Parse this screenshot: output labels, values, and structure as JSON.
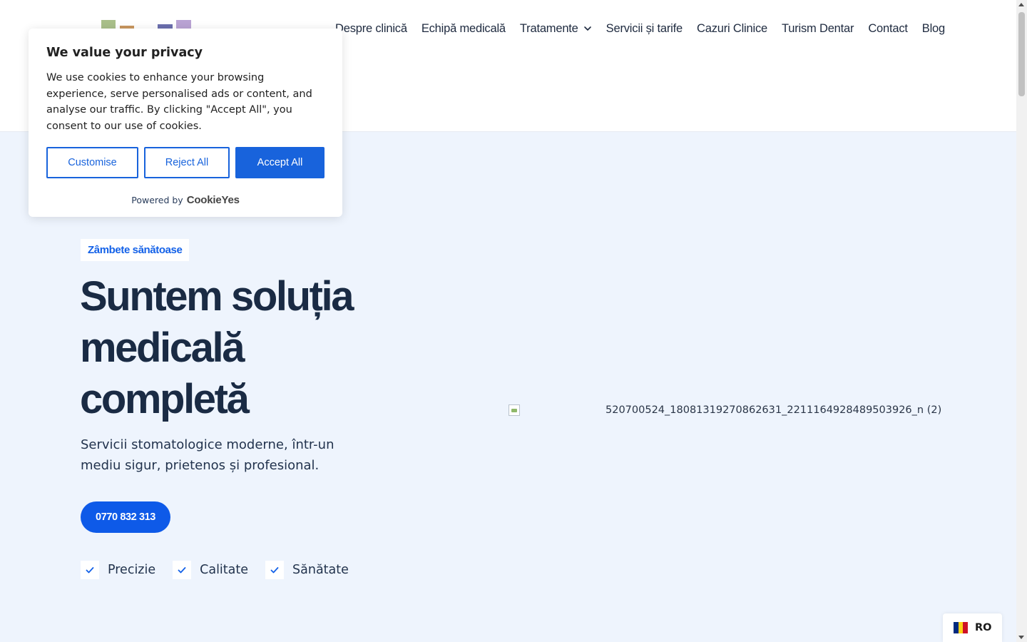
{
  "header": {
    "nav": [
      {
        "label": "Despre clinică"
      },
      {
        "label": "Echipă medicală"
      },
      {
        "label": "Tratamente",
        "has_dropdown": true
      },
      {
        "label": "Servicii și tarife"
      },
      {
        "label": "Cazuri Clinice"
      },
      {
        "label": "Turism Dentar"
      },
      {
        "label": "Contact"
      },
      {
        "label": "Blog"
      }
    ]
  },
  "hero": {
    "badge": "Zâmbete sănătoase",
    "title": "Suntem soluția medicală completă",
    "subtitle": "Servicii stomatologice moderne, într-un mediu sigur, prietenos și profesional.",
    "cta_phone": "0770 832 313",
    "features": [
      {
        "label": "Precizie"
      },
      {
        "label": "Calitate"
      },
      {
        "label": "Sănătate"
      }
    ],
    "image_alt": "520700524_18081319270862631_2211164928489503926_n (2)"
  },
  "cookie_banner": {
    "title": "We value your privacy",
    "text": "We use cookies to enhance your browsing experience, serve personalised ads or content, and analyse our traffic. By clicking \"Accept All\", you consent to our use of cookies.",
    "customise_label": "Customise",
    "reject_label": "Reject All",
    "accept_label": "Accept All",
    "powered_by": "Powered by",
    "powered_brand": "CookieYes"
  },
  "language": {
    "code": "RO",
    "flag_colors": [
      "#002b7f",
      "#fcd116",
      "#ce1126"
    ]
  },
  "colors": {
    "accent": "#0e5ae8",
    "hero_bg": "#eef4fd",
    "heading": "#1a2b44",
    "cookie_accent": "#1863dc"
  }
}
